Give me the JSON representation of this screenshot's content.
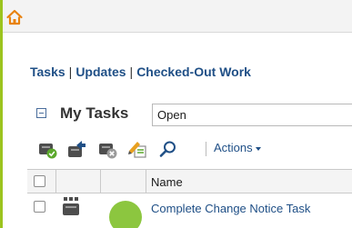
{
  "header": {
    "home_icon": "home-icon",
    "accent_color": "#9cc41e",
    "home_color": "#e8820c"
  },
  "nav": {
    "tabs": [
      {
        "label": "Tasks"
      },
      {
        "label": "Updates"
      },
      {
        "label": "Checked-Out Work"
      }
    ],
    "separator": "|"
  },
  "panel": {
    "title": "My Tasks",
    "filter_value": "Open"
  },
  "toolbar": {
    "icons": [
      "task-complete-icon",
      "task-forward-icon",
      "task-remove-icon",
      "task-edit-icon",
      "search-icon"
    ],
    "actions_label": "Actions"
  },
  "table": {
    "columns": [
      "",
      "",
      "",
      "Name"
    ],
    "rows": [
      {
        "name": "Complete Change Notice Task",
        "status_color": "#8cc63f",
        "type_icon": "workitem-icon"
      }
    ]
  }
}
